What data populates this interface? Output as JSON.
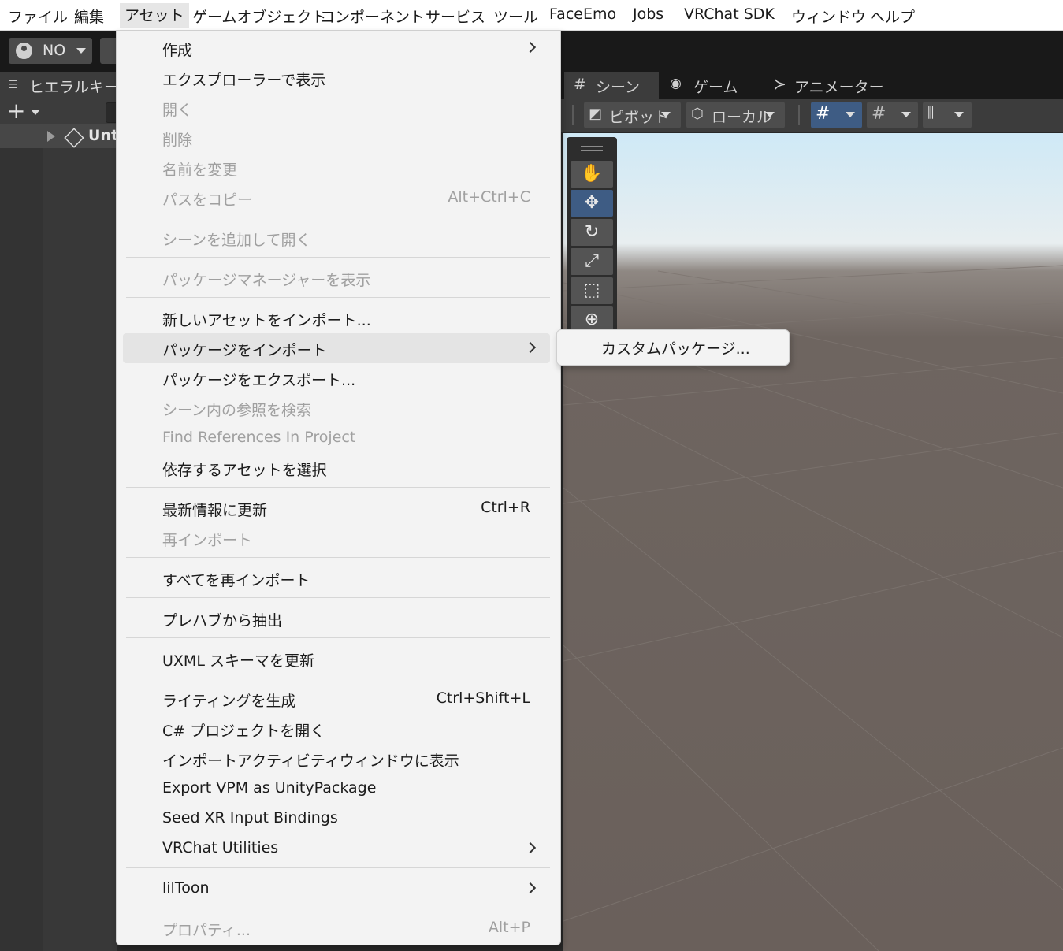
{
  "menubar": {
    "items": [
      "ファイル",
      "編集",
      "アセット",
      "ゲームオブジェクト",
      "コンポーネント",
      "サービス",
      "ツール",
      "FaceEmo",
      "Jobs",
      "VRChat SDK",
      "ウィンドウ",
      "ヘルプ"
    ],
    "active_index": 2
  },
  "toolbar": {
    "account_label": "NO"
  },
  "hierarchy": {
    "tab_label": "ヒエラルキー",
    "scene_row": "Unt"
  },
  "scene": {
    "tabs": [
      "シーン",
      "ゲーム",
      "アニメーター"
    ],
    "pivot_label": "ピボット",
    "local_label": "ローカル"
  },
  "asset_menu": {
    "items": [
      {
        "label": "作成",
        "shortcut": "",
        "submenu": true,
        "disabled": false
      },
      {
        "label": "エクスプローラーで表示",
        "shortcut": "",
        "submenu": false,
        "disabled": false
      },
      {
        "label": "開く",
        "shortcut": "",
        "submenu": false,
        "disabled": true
      },
      {
        "label": "削除",
        "shortcut": "",
        "submenu": false,
        "disabled": true
      },
      {
        "label": "名前を変更",
        "shortcut": "",
        "submenu": false,
        "disabled": true
      },
      {
        "label": "パスをコピー",
        "shortcut": "Alt+Ctrl+C",
        "submenu": false,
        "disabled": true
      },
      {
        "label": "シーンを追加して開く",
        "shortcut": "",
        "submenu": false,
        "disabled": true
      },
      {
        "label": "パッケージマネージャーを表示",
        "shortcut": "",
        "submenu": false,
        "disabled": true
      },
      {
        "label": "新しいアセットをインポート...",
        "shortcut": "",
        "submenu": false,
        "disabled": false
      },
      {
        "label": "パッケージをインポート",
        "shortcut": "",
        "submenu": true,
        "disabled": false
      },
      {
        "label": "パッケージをエクスポート...",
        "shortcut": "",
        "submenu": false,
        "disabled": false
      },
      {
        "label": "シーン内の参照を検索",
        "shortcut": "",
        "submenu": false,
        "disabled": true
      },
      {
        "label": "Find References In Project",
        "shortcut": "",
        "submenu": false,
        "disabled": true
      },
      {
        "label": "依存するアセットを選択",
        "shortcut": "",
        "submenu": false,
        "disabled": false
      },
      {
        "label": "最新情報に更新",
        "shortcut": "Ctrl+R",
        "submenu": false,
        "disabled": false
      },
      {
        "label": "再インポート",
        "shortcut": "",
        "submenu": false,
        "disabled": true
      },
      {
        "label": "すべてを再インポート",
        "shortcut": "",
        "submenu": false,
        "disabled": false
      },
      {
        "label": "プレハブから抽出",
        "shortcut": "",
        "submenu": false,
        "disabled": false
      },
      {
        "label": "UXML スキーマを更新",
        "shortcut": "",
        "submenu": false,
        "disabled": false
      },
      {
        "label": "ライティングを生成",
        "shortcut": "Ctrl+Shift+L",
        "submenu": false,
        "disabled": false
      },
      {
        "label": "C# プロジェクトを開く",
        "shortcut": "",
        "submenu": false,
        "disabled": false
      },
      {
        "label": "インポートアクティビティウィンドウに表示",
        "shortcut": "",
        "submenu": false,
        "disabled": false
      },
      {
        "label": "Export VPM as UnityPackage",
        "shortcut": "",
        "submenu": false,
        "disabled": false
      },
      {
        "label": "Seed XR Input Bindings",
        "shortcut": "",
        "submenu": false,
        "disabled": false
      },
      {
        "label": "VRChat Utilities",
        "shortcut": "",
        "submenu": true,
        "disabled": false
      },
      {
        "label": "lilToon",
        "shortcut": "",
        "submenu": true,
        "disabled": false
      },
      {
        "label": "プロパティ...",
        "shortcut": "Alt+P",
        "submenu": false,
        "disabled": true
      }
    ]
  },
  "import_package_submenu": {
    "items": [
      "カスタムパッケージ..."
    ]
  }
}
